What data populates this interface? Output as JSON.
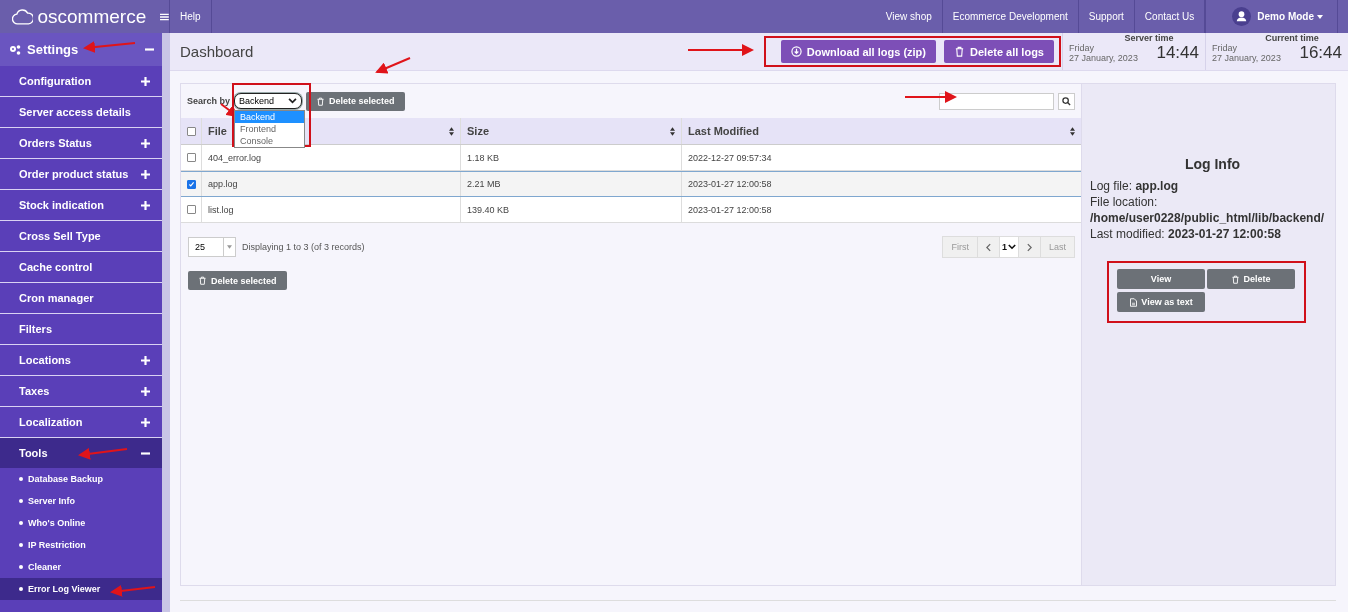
{
  "topbar": {
    "logo": "oscommerce",
    "help": "Help",
    "links": [
      "View shop",
      "Ecommerce Development",
      "Support",
      "Contact Us"
    ],
    "user": "Demo Mode"
  },
  "sidebar": {
    "section": {
      "label": "Settings",
      "expanded": true
    },
    "items": [
      {
        "label": "Configuration",
        "expandable": true,
        "expanded": false
      },
      {
        "label": "Server access details",
        "expandable": false,
        "expanded": false
      },
      {
        "label": "Orders Status",
        "expandable": true,
        "expanded": false
      },
      {
        "label": "Order product status",
        "expandable": true,
        "expanded": false
      },
      {
        "label": "Stock indication",
        "expandable": true,
        "expanded": false
      },
      {
        "label": "Cross Sell Type",
        "expandable": false,
        "expanded": false
      },
      {
        "label": "Cache control",
        "expandable": false,
        "expanded": false
      },
      {
        "label": "Cron manager",
        "expandable": false,
        "expanded": false
      },
      {
        "label": "Filters",
        "expandable": false,
        "expanded": false
      },
      {
        "label": "Locations",
        "expandable": true,
        "expanded": false
      },
      {
        "label": "Taxes",
        "expandable": true,
        "expanded": false
      },
      {
        "label": "Localization",
        "expandable": true,
        "expanded": false
      },
      {
        "label": "Tools",
        "expandable": true,
        "expanded": true,
        "children": [
          {
            "label": "Database Backup",
            "selected": false
          },
          {
            "label": "Server Info",
            "selected": false
          },
          {
            "label": "Who's Online",
            "selected": false
          },
          {
            "label": "IP Restriction",
            "selected": false
          },
          {
            "label": "Cleaner",
            "selected": false
          },
          {
            "label": "Error Log Viewer",
            "selected": true
          }
        ]
      }
    ]
  },
  "header": {
    "title": "Dashboard",
    "buttons": [
      {
        "kind": "download",
        "label": "Download all logs (zip)"
      },
      {
        "kind": "delete",
        "label": "Delete all logs"
      }
    ],
    "clocks": [
      {
        "title": "Server time",
        "day": "Friday",
        "date": "27 January, 2023",
        "time": "14:44"
      },
      {
        "title": "Current time",
        "day": "Friday",
        "date": "27 January, 2023",
        "time": "16:44"
      }
    ]
  },
  "toolbar": {
    "search_by": "Search by",
    "select": {
      "value": "Backend",
      "open": true,
      "options": [
        {
          "label": "Backend",
          "selected": true
        },
        {
          "label": "Frontend",
          "selected": false
        },
        {
          "label": "Console",
          "selected": false
        }
      ]
    },
    "delete_selected": "Delete selected"
  },
  "table": {
    "header_checked": false,
    "columns": [
      "File",
      "Size",
      "Last Modified"
    ],
    "rows": [
      {
        "checked": false,
        "selected": false,
        "cells": [
          "404_error.log",
          "1.18 KB",
          "2022-12-27 09:57:34"
        ]
      },
      {
        "checked": true,
        "selected": true,
        "cells": [
          "app.log",
          "2.21 MB",
          "2023-01-27 12:00:58"
        ]
      },
      {
        "checked": false,
        "selected": false,
        "cells": [
          "list.log",
          "139.40 KB",
          "2023-01-27 12:00:58"
        ]
      }
    ]
  },
  "footer": {
    "page_size": "25",
    "displaying": "Displaying 1 to 3 (of 3 records)",
    "pager": {
      "first": "First",
      "page": "1",
      "last": "Last"
    },
    "delete_selected": "Delete selected"
  },
  "log_info": {
    "title": "Log Info",
    "lines": [
      "Log file: **app.log**",
      "File location:",
      "**/home/user0228/public_html/lib/backend/**",
      "Last modified: **2023-01-27 12:00:58**"
    ],
    "buttons": [
      {
        "kind": "plain",
        "label": "View"
      },
      {
        "kind": "delete",
        "label": "Delete"
      },
      {
        "kind": "text",
        "label": "View as text"
      }
    ]
  }
}
